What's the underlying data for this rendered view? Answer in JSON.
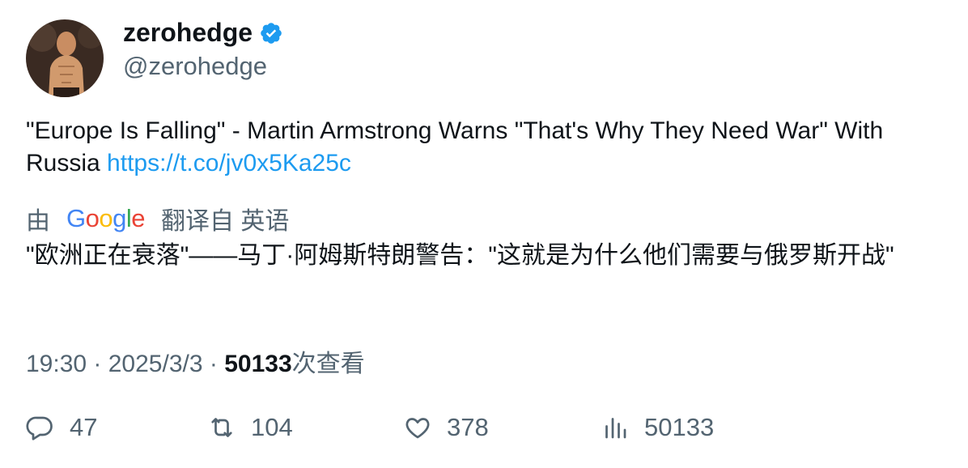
{
  "user": {
    "display_name": "zerohedge",
    "handle": "@zerohedge",
    "verified": true,
    "verified_color": "#1d9bf0"
  },
  "tweet": {
    "text": "\"Europe Is Falling\" - Martin Armstrong Warns \"That's Why They Need War\" With Russia",
    "link": "https://t.co/jv0x5Ka25c"
  },
  "translation": {
    "by_label": "由",
    "provider": "Google",
    "from_label": "翻译自 英语",
    "text": "\"欧洲正在衰落\"——马丁·阿姆斯特朗警告：\"这就是为什么他们需要与俄罗斯开战\""
  },
  "meta": {
    "time": "19:30",
    "date": "2025/3/3",
    "separator": "·",
    "views": "50133",
    "views_label": "次查看"
  },
  "actions": {
    "replies": "47",
    "retweets": "104",
    "likes": "378",
    "views": "50133"
  },
  "icons": {
    "reply": "reply-icon",
    "retweet": "retweet-icon",
    "like": "heart-icon",
    "views": "bar-chart-icon",
    "verified": "verified-badge-icon"
  }
}
